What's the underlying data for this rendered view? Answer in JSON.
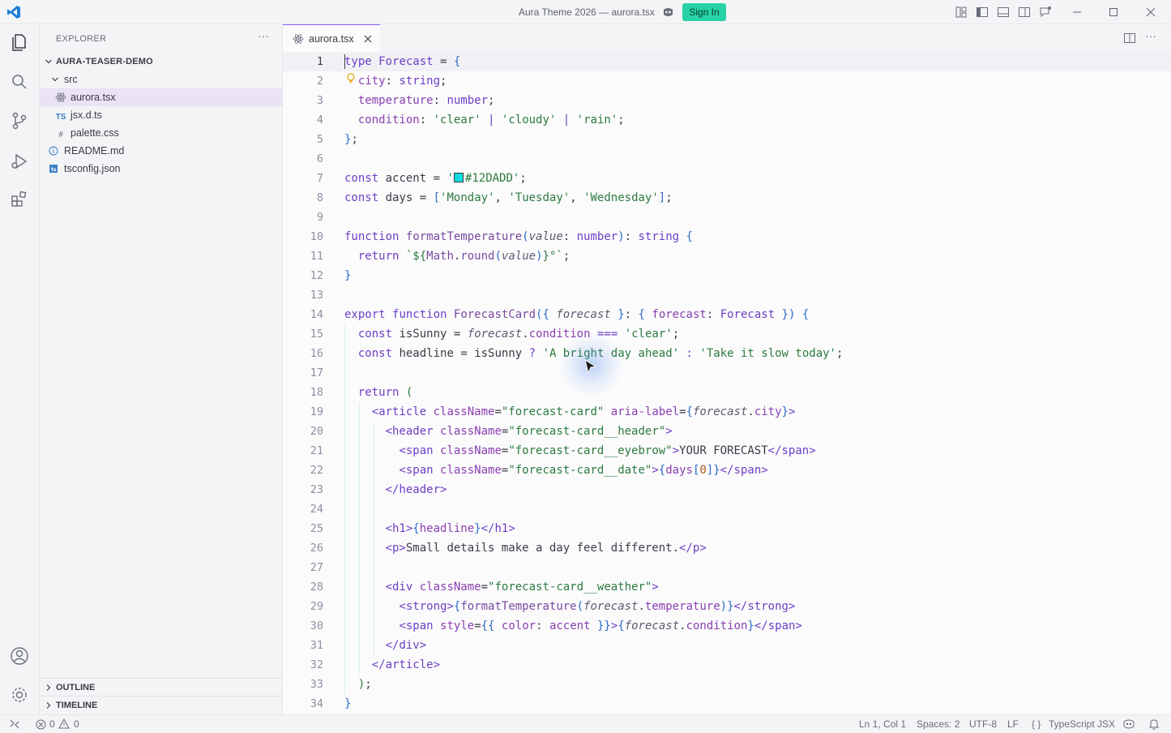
{
  "window": {
    "title": "Aura Theme 2026 — aurora.tsx",
    "signin_label": "Sign In"
  },
  "colors": {
    "accent_purple": "#8b5cf6",
    "signin_green": "#27d3a6",
    "swatch": "#12DADD"
  },
  "activity_icons": [
    "files-icon",
    "search-icon",
    "source-control-icon",
    "run-debug-icon",
    "extensions-icon",
    "account-icon",
    "settings-gear-icon"
  ],
  "sidebar": {
    "header": "EXPLORER",
    "more": "···",
    "project": "AURA-TEASER-DEMO",
    "folder": "src",
    "files": [
      {
        "name": "aurora.tsx",
        "icon": "react-icon"
      },
      {
        "name": "jsx.d.ts",
        "icon": "TS"
      },
      {
        "name": "palette.css",
        "icon": "#"
      },
      {
        "name": "README.md",
        "icon": "info-icon"
      },
      {
        "name": "tsconfig.json",
        "icon": "tsconfig-icon"
      }
    ],
    "outline": "OUTLINE",
    "timeline": "TIMELINE"
  },
  "editor": {
    "tab_label": "aurora.tsx",
    "more": "···",
    "line_numbers": [
      "1",
      "2",
      "3",
      "4",
      "5",
      "6",
      "7",
      "8",
      "9",
      "10",
      "11",
      "12",
      "13",
      "14",
      "15",
      "16",
      "17",
      "18",
      "19",
      "20",
      "21",
      "22",
      "23",
      "24",
      "25",
      "26",
      "27",
      "28",
      "29",
      "30",
      "31",
      "32",
      "33",
      "34"
    ],
    "swatch_text": "#12DADD"
  },
  "status": {
    "errors": "0",
    "warnings": "0",
    "position": "Ln 1, Col 1",
    "spaces": "Spaces: 2",
    "encoding": "UTF-8",
    "eol": "LF",
    "language": "TypeScript JSX"
  }
}
